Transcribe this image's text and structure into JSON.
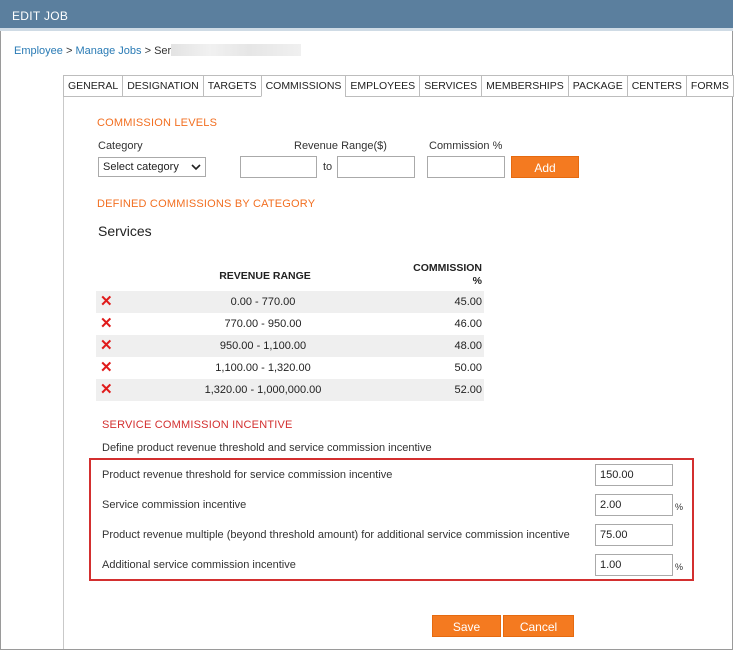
{
  "window": {
    "title": "EDIT JOB"
  },
  "breadcrumb": {
    "employee": "Employee",
    "sep1": " > ",
    "manage_jobs": "Manage Jobs",
    "sep2": " > ",
    "current": "Ser"
  },
  "tabs": [
    {
      "label": "GENERAL"
    },
    {
      "label": "DESIGNATION"
    },
    {
      "label": "TARGETS"
    },
    {
      "label": "COMMISSIONS"
    },
    {
      "label": "EMPLOYEES"
    },
    {
      "label": "SERVICES"
    },
    {
      "label": "MEMBERSHIPS"
    },
    {
      "label": "PACKAGE"
    },
    {
      "label": "CENTERS"
    },
    {
      "label": "FORMS"
    }
  ],
  "commission_levels": {
    "title": "COMMISSION LEVELS",
    "category_label": "Category",
    "category_select": "Select category",
    "revenue_range_label": "Revenue Range($)",
    "to_label": "to",
    "commission_label": "Commission %",
    "add_button": "Add",
    "range_from_value": "",
    "range_to_value": "",
    "commission_value": ""
  },
  "defined": {
    "title": "DEFINED COMMISSIONS BY CATEGORY",
    "category_name": "Services",
    "col_range": "REVENUE RANGE",
    "col_commission_1": "COMMISSION",
    "col_commission_2": "%",
    "rows": [
      {
        "range": "0.00 - 770.00",
        "commission": "45.00"
      },
      {
        "range": "770.00 - 950.00",
        "commission": "46.00"
      },
      {
        "range": "950.00 - 1,100.00",
        "commission": "48.00"
      },
      {
        "range": "1,100.00 - 1,320.00",
        "commission": "50.00"
      },
      {
        "range": "1,320.00 - 1,000,000.00",
        "commission": "52.00"
      }
    ]
  },
  "incentive": {
    "title": "SERVICE COMMISSION INCENTIVE",
    "description": "Define product revenue threshold and service commission incentive",
    "fields": [
      {
        "label": "Product revenue threshold for service commission incentive",
        "value": "150.00",
        "suffix": ""
      },
      {
        "label": "Service commission incentive",
        "value": "2.00",
        "suffix": "%"
      },
      {
        "label": "Product revenue multiple (beyond threshold amount) for additional service commission incentive",
        "value": "75.00",
        "suffix": ""
      },
      {
        "label": "Additional service commission incentive",
        "value": "1.00",
        "suffix": "%"
      }
    ]
  },
  "actions": {
    "save": "Save",
    "cancel": "Cancel"
  },
  "colors": {
    "titlebar": "#5b7f9e",
    "accent": "#f47a20",
    "section_orange": "#f26f21",
    "section_red": "#d32f2f",
    "delete": "#e01b1b"
  }
}
